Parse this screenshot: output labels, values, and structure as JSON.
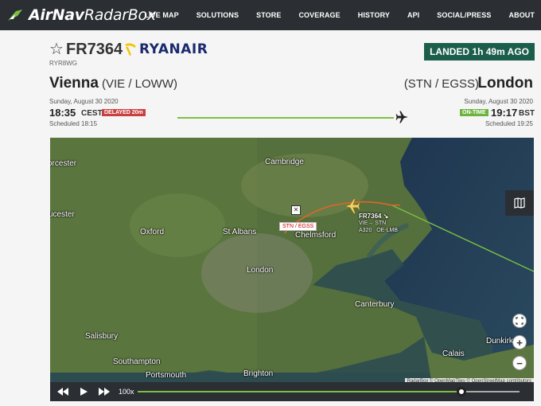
{
  "nav": {
    "brand_bold": "AirNav",
    "brand_light": "RadarBox",
    "items": [
      "LIVE MAP",
      "SOLUTIONS",
      "STORE",
      "COVERAGE",
      "HISTORY",
      "API",
      "SOCIAL/PRESS",
      "ABOUT"
    ]
  },
  "flight": {
    "star_icon": "star-outline-icon",
    "number": "FR7364",
    "airline": "RYANAIR",
    "callsign": "RYR8WG",
    "status": "LANDED 1h 49m AGO"
  },
  "origin": {
    "city": "Vienna",
    "codes": "(VIE / LOWW)",
    "date": "Sunday, August 30 2020",
    "time": "18:35",
    "tz": "CEST",
    "badge": "DELAYED 20m",
    "scheduled": "Scheduled 18:15"
  },
  "destination": {
    "city": "London",
    "codes": "(STN / EGSS)",
    "date": "Sunday, August 30 2020",
    "time": "19:17",
    "tz": "BST",
    "badge": "ON-TIME",
    "scheduled": "Scheduled 19:25"
  },
  "map": {
    "labels": {
      "worcester": "orcester",
      "gloucester": "ucester",
      "cambridge": "Cambridge",
      "oxford": "Oxford",
      "st_albans": "St Albans",
      "chelmsford": "Chelmsford",
      "london": "London",
      "canterbury": "Canterbury",
      "salisbury": "Salisbury",
      "southampton": "Southampton",
      "portsmouth": "Portsmouth",
      "brighton": "Brighton",
      "calais": "Calais",
      "dunkirk": "Dunkirk"
    },
    "route_label": "STN / EGSS",
    "tag": {
      "line1": "FR7364 ↘",
      "line2": "VIE→ STN",
      "aircraft": "A320",
      "registration": "OE-LMB"
    },
    "zoom_in": "+",
    "zoom_out": "−",
    "attribution": "RadarBox © OpenMapTiles © OpenStreetMap contributors"
  },
  "playback": {
    "speed": "100x",
    "progress": 0.85
  },
  "colors": {
    "accent_green": "#7bc043",
    "status_green": "#1c5e4c",
    "delayed_red": "#c94040",
    "route_orange": "#e0662a"
  }
}
